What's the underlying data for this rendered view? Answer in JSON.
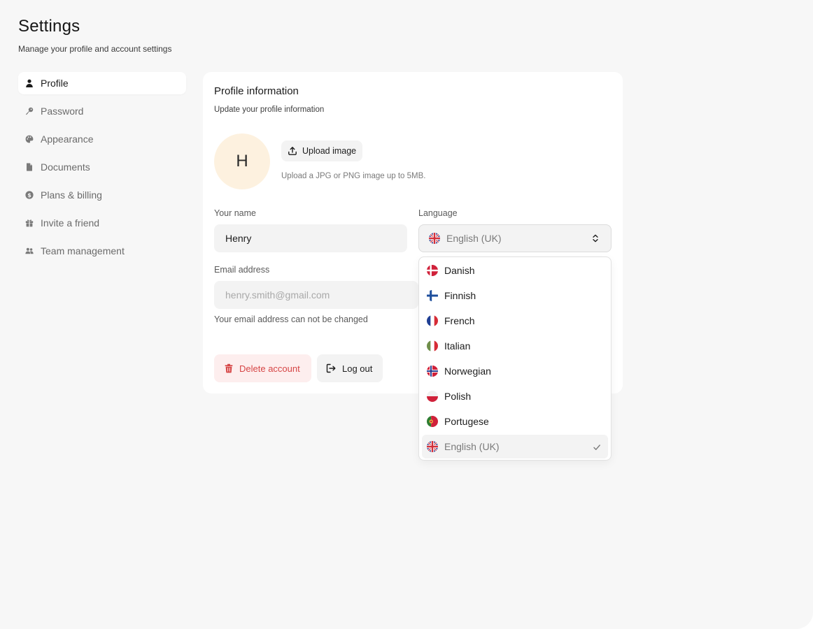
{
  "page": {
    "title": "Settings",
    "subtitle": "Manage your profile and account settings"
  },
  "sidebar": {
    "items": [
      {
        "label": "Profile",
        "icon": "user-icon",
        "active": true
      },
      {
        "label": "Password",
        "icon": "key-icon",
        "active": false
      },
      {
        "label": "Appearance",
        "icon": "palette-icon",
        "active": false
      },
      {
        "label": "Documents",
        "icon": "document-icon",
        "active": false
      },
      {
        "label": "Plans & billing",
        "icon": "dollar-icon",
        "active": false
      },
      {
        "label": "Invite a friend",
        "icon": "gift-icon",
        "active": false
      },
      {
        "label": "Team management",
        "icon": "users-icon",
        "active": false
      }
    ]
  },
  "profile": {
    "title": "Profile information",
    "subtitle": "Update your profile information",
    "avatar_initial": "H",
    "upload_label": "Upload image",
    "upload_help": "Upload a JPG or PNG image up to 5MB.",
    "name_label": "Your name",
    "name_value": "Henry",
    "language_label": "Language",
    "language_value": "English (UK)",
    "email_label": "Email address",
    "email_value": "henry.smith@gmail.com",
    "email_help": "Your email address can not be changed",
    "delete_label": "Delete account",
    "logout_label": "Log out"
  },
  "language_dropdown": {
    "options": [
      {
        "label": "Danish",
        "flag": "denmark-flag-icon"
      },
      {
        "label": "Finnish",
        "flag": "finland-flag-icon"
      },
      {
        "label": "French",
        "flag": "france-flag-icon"
      },
      {
        "label": "Italian",
        "flag": "italy-flag-icon"
      },
      {
        "label": "Norwegian",
        "flag": "norway-flag-icon"
      },
      {
        "label": "Polish",
        "flag": "poland-flag-icon"
      },
      {
        "label": "Portugese",
        "flag": "portugal-flag-icon"
      },
      {
        "label": "English (UK)",
        "flag": "uk-flag-icon",
        "selected": true
      }
    ]
  },
  "colors": {
    "background": "#f7f7f7",
    "card": "#ffffff",
    "avatar_bg": "#fdf1df",
    "danger": "#d64545",
    "danger_bg": "#fdeeee"
  }
}
